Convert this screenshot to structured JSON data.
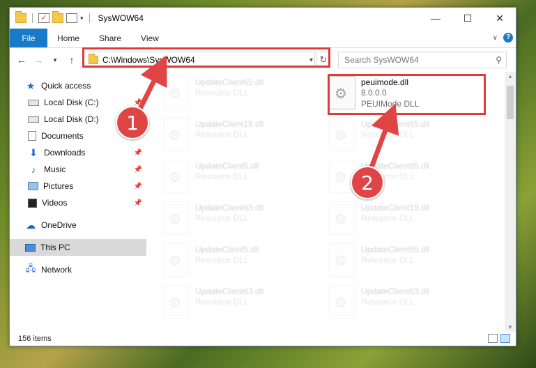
{
  "window": {
    "title": "SysWOW64"
  },
  "ribbon": {
    "tabs": [
      "File",
      "Home",
      "Share",
      "View"
    ]
  },
  "address": {
    "path": "C:\\Windows\\SysWOW64",
    "search_placeholder": "Search SysWOW64"
  },
  "sidebar": {
    "items": [
      {
        "label": "Quick access",
        "icon": "star-icon",
        "pinned": false
      },
      {
        "label": "Local Disk (C:)",
        "icon": "drive-icon",
        "pinned": true
      },
      {
        "label": "Local Disk (D:)",
        "icon": "drive-icon",
        "pinned": false
      },
      {
        "label": "Documents",
        "icon": "documents-icon",
        "pinned": true
      },
      {
        "label": "Downloads",
        "icon": "downloads-icon",
        "pinned": true
      },
      {
        "label": "Music",
        "icon": "music-icon",
        "pinned": true
      },
      {
        "label": "Pictures",
        "icon": "pictures-icon",
        "pinned": true
      },
      {
        "label": "Videos",
        "icon": "videos-icon",
        "pinned": true
      },
      {
        "label": "OneDrive",
        "icon": "onedrive-icon",
        "pinned": false
      },
      {
        "label": "This PC",
        "icon": "pc-icon",
        "pinned": false,
        "selected": true
      },
      {
        "label": "Network",
        "icon": "network-icon",
        "pinned": false
      }
    ]
  },
  "files": {
    "highlighted": {
      "name": "peuimode.dll",
      "version": "8.0.0.0",
      "description": "PEUIMode DLL"
    },
    "left_column": [
      {
        "name": "UpdateClient65.dll",
        "type": "Resource DLL"
      },
      {
        "name": "UpdateClient19.dll",
        "type": "Resource DLL"
      },
      {
        "name": "UpdateClient5.dll",
        "type": "Resource DLL"
      },
      {
        "name": "UpdateClient63.dll",
        "type": "Resource DLL"
      },
      {
        "name": "UpdateClient5.dll",
        "type": "Resource DLL"
      },
      {
        "name": "UpdateClient63.dll",
        "type": "Resource DLL"
      }
    ],
    "right_column": [
      {
        "name": "UpdateClient65.dll",
        "type": "Resource DLL"
      },
      {
        "name": "UpdateClient65.dll",
        "type": "Resource DLL"
      },
      {
        "name": "UpdateClient19.dll",
        "type": "Resource DLL"
      },
      {
        "name": "UpdateClient65.dll",
        "type": "Resource DLL"
      },
      {
        "name": "UpdateClient63.dll",
        "type": "Resource DLL"
      }
    ]
  },
  "status": {
    "item_count": "156 items"
  },
  "annotations": {
    "step1": "1",
    "step2": "2",
    "highlight_color": "#e03b3b"
  }
}
